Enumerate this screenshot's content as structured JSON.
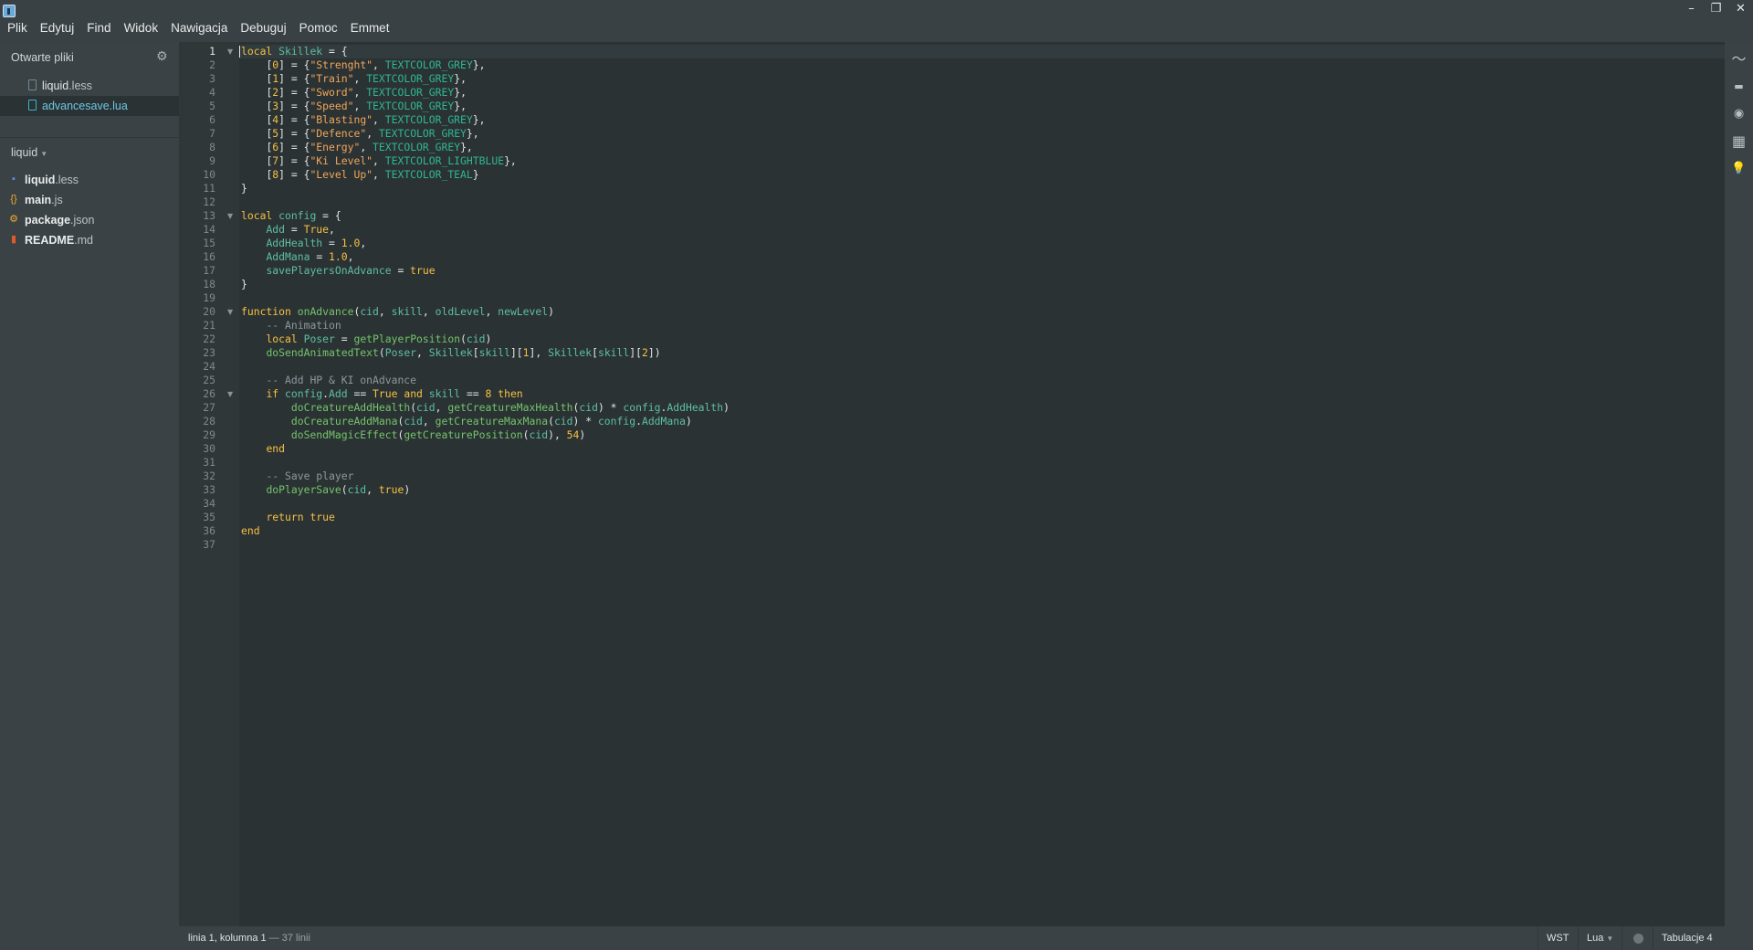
{
  "menu": [
    "Plik",
    "Edytuj",
    "Find",
    "Widok",
    "Nawigacja",
    "Debuguj",
    "Pomoc",
    "Emmet"
  ],
  "window_controls": {
    "minimize": "–",
    "restore": "❐",
    "close": "✕"
  },
  "sidebar": {
    "open_files_title": "Otwarte pliki",
    "open_files": [
      {
        "name": "liquid",
        "ext": ".less",
        "label": "liquid.less",
        "active": false
      },
      {
        "name": "advancesave",
        "ext": ".lua",
        "label": "advancesave.lua",
        "active": true
      }
    ],
    "project_name": "liquid",
    "tree": [
      {
        "name": "liquid",
        "ext": ".less",
        "icon": "less-file-icon",
        "color": "#5b8fd6"
      },
      {
        "name": "main",
        "ext": ".js",
        "icon": "js-file-icon",
        "color": "#f0a830"
      },
      {
        "name": "package",
        "ext": ".json",
        "icon": "gear-icon",
        "color": "#f0a830"
      },
      {
        "name": "README",
        "ext": ".md",
        "icon": "book-icon",
        "color": "#e0592a"
      }
    ]
  },
  "editor": {
    "line_count": 37,
    "active_line": 1,
    "folds": [
      1,
      13,
      20,
      26
    ],
    "lines": [
      "local Skillek = {",
      "    [0] = {\"Strenght\", TEXTCOLOR_GREY},",
      "    [1] = {\"Train\", TEXTCOLOR_GREY},",
      "    [2] = {\"Sword\", TEXTCOLOR_GREY},",
      "    [3] = {\"Speed\", TEXTCOLOR_GREY},",
      "    [4] = {\"Blasting\", TEXTCOLOR_GREY},",
      "    [5] = {\"Defence\", TEXTCOLOR_GREY},",
      "    [6] = {\"Energy\", TEXTCOLOR_GREY},",
      "    [7] = {\"Ki Level\", TEXTCOLOR_LIGHTBLUE},",
      "    [8] = {\"Level Up\", TEXTCOLOR_TEAL}",
      "}",
      "",
      "local config = {",
      "    Add = True,",
      "    AddHealth = 1.0,",
      "    AddMana = 1.0,",
      "    savePlayersOnAdvance = true",
      "}",
      "",
      "function onAdvance(cid, skill, oldLevel, newLevel)",
      "    -- Animation",
      "    local Poser = getPlayerPosition(cid)",
      "    doSendAnimatedText(Poser, Skillek[skill][1], Skillek[skill][2])",
      "",
      "    -- Add HP & KI onAdvance",
      "    if config.Add == True and skill == 8 then",
      "        doCreatureAddHealth(cid, getCreatureMaxHealth(cid) * config.AddHealth)",
      "        doCreatureAddMana(cid, getCreatureMaxMana(cid) * config.AddMana)",
      "        doSendMagicEffect(getCreaturePosition(cid), 54)",
      "    end",
      "",
      "    -- Save player",
      "    doPlayerSave(cid, true)",
      "",
      "    return true",
      "end",
      ""
    ]
  },
  "right_toolbar": [
    {
      "icon": "live-preview-icon",
      "glyph": "〜"
    },
    {
      "icon": "extension-manager-icon",
      "glyph": "▬"
    },
    {
      "icon": "theme-icon",
      "glyph": "◉"
    },
    {
      "icon": "layout-icon",
      "glyph": "▦"
    },
    {
      "icon": "lightbulb-icon",
      "glyph": "💡"
    }
  ],
  "status": {
    "position": "linia 1, kolumna 1",
    "sep": " — ",
    "line_total": "37 linii",
    "insert_mode": "WST",
    "language": "Lua",
    "indent": "Tabulacje 4"
  }
}
